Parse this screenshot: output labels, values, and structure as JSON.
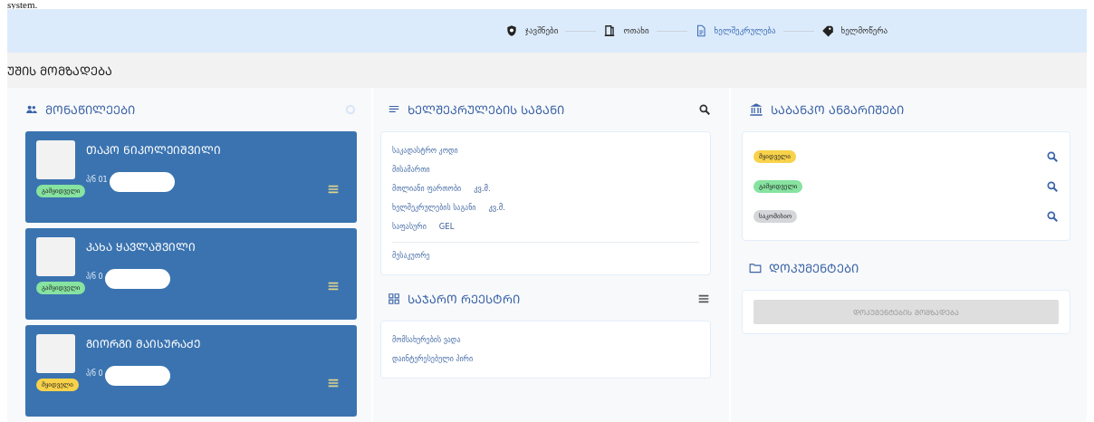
{
  "document_text": "system.",
  "stepper": [
    {
      "label": "ჯავშნები",
      "selected": false
    },
    {
      "label": "ოთახი",
      "selected": false
    },
    {
      "label": "ხელშეკრულება",
      "selected": true
    },
    {
      "label": "ხელმოწერა",
      "selected": false
    }
  ],
  "page_title": "ᲣᲨᲘᲡ ᲛᲝᲛᲖᲐᲓᲔᲑᲐ",
  "participants": {
    "title": "ᲛᲝᲜᲐᲬᲘᲚᲔᲔᲑᲘ",
    "cards": [
      {
        "name": "ᲗᲐᲙᲝ ᲜᲘᲙᲝᲚᲔᲘᲨᲕᲘᲚᲘ",
        "id": "პ/ნ 01",
        "badge": "გამყიდველი",
        "color": "#86e3a0"
      },
      {
        "name": "ᲙᲐᲮᲐ ᲧᲐᲕᲚᲐᲨᲕᲘᲚᲘ",
        "id": "პ/ნ 0",
        "badge": "გამყიდველი",
        "color": "#86e3a0"
      },
      {
        "name": "ᲒᲘᲝᲠᲒᲘ ᲛᲐᲘᲡᲣᲠᲐᲫᲔ",
        "id": "პ/ნ 0",
        "badge": "მყიდველი",
        "color": "#f8d24a"
      }
    ]
  },
  "contract_subject": {
    "title": "ᲮᲔᲚᲨᲔᲙᲠᲣᲚᲔᲑᲘᲡ ᲡᲐᲒᲐᲜᲘ",
    "fields": [
      {
        "label": "საკადასტრო კოდი"
      },
      {
        "label": "მისამართი"
      },
      {
        "label": "მთლიანი ფართობი",
        "unit": "კვ.მ."
      },
      {
        "label": "ხელშეკრულების საგანი",
        "unit": "კვ.მ."
      },
      {
        "label": "საფასური",
        "unit": "GEL"
      }
    ],
    "footer": "მესაკუთრე"
  },
  "public_registry": {
    "title": "ᲡᲐᲯᲐᲠᲝ ᲠᲔᲔᲡᲢᲠᲘ",
    "fields": [
      "მომსახურების ვადა",
      "დაინტერესებული პირი"
    ]
  },
  "bank_accounts": {
    "title": "ᲡᲐᲑᲐᲜᲙᲝ ᲐᲜᲒᲐᲠᲘᲨᲔᲑᲘ",
    "rows": [
      {
        "badge": "მყიდველი",
        "color": "#f8d24a"
      },
      {
        "badge": "გამყიდველი",
        "color": "#86e3a0"
      },
      {
        "badge": "საკომისიო",
        "color": "#d4d6da"
      }
    ]
  },
  "documents": {
    "title": "ᲓᲝᲙᲣᲛᲔᲜᲢᲔᲑᲘ",
    "button": "ᲓᲝᲙᲣᲛᲔᲜᲢᲔᲑᲘᲡ ᲛᲝᲛᲖᲐᲓᲔᲑᲐ",
    "disabled": true
  }
}
